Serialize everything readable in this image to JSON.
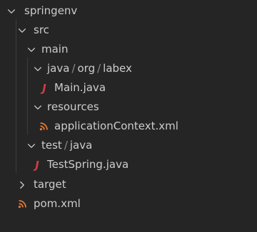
{
  "explorer": {
    "tree": {
      "root": {
        "label": "springenv",
        "expanded": true
      },
      "src": {
        "label": "src",
        "expanded": true
      },
      "main": {
        "label": "main",
        "expanded": true
      },
      "main_java_path": {
        "parts": [
          "java",
          "org",
          "labex"
        ],
        "separator": "/",
        "expanded": true
      },
      "main_java_file": {
        "label": "Main.java",
        "icon": "java-icon",
        "icon_glyph": "J"
      },
      "resources": {
        "label": "resources",
        "expanded": true
      },
      "app_context": {
        "label": "applicationContext.xml",
        "icon": "xml-rss-icon"
      },
      "test_path": {
        "parts": [
          "test",
          "java"
        ],
        "separator": "/",
        "expanded": true
      },
      "test_java_file": {
        "label": "TestSpring.java",
        "icon": "java-icon",
        "icon_glyph": "J"
      },
      "target": {
        "label": "target",
        "expanded": false
      },
      "pom": {
        "label": "pom.xml",
        "icon": "xml-rss-icon"
      }
    },
    "colors": {
      "background": "#252526",
      "text": "#cccccc",
      "java_icon": "#cc3e44",
      "xml_icon": "#e37933",
      "indent_guide": "#3c3c3c"
    }
  }
}
